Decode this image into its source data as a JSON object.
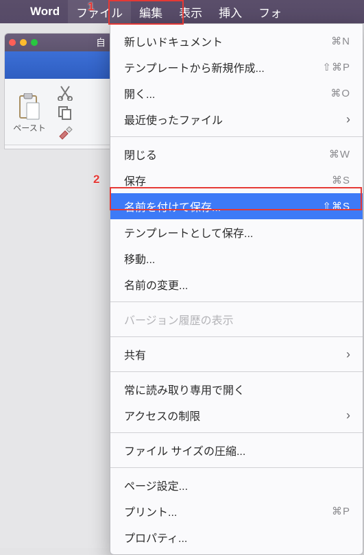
{
  "menubar": {
    "app_name": "Word",
    "items": [
      "ファイル",
      "編集",
      "表示",
      "挿入",
      "フォ"
    ]
  },
  "window": {
    "autofit": "自",
    "paste_label": "ペースト"
  },
  "annotations": {
    "one": "1",
    "two": "2"
  },
  "menu": [
    {
      "type": "item",
      "label": "新しいドキュメント",
      "shortcut": "⌘N"
    },
    {
      "type": "item",
      "label": "テンプレートから新規作成...",
      "shortcut": "⇧⌘P"
    },
    {
      "type": "item",
      "label": "開く...",
      "shortcut": "⌘O"
    },
    {
      "type": "submenu",
      "label": "最近使ったファイル"
    },
    {
      "type": "sep"
    },
    {
      "type": "item",
      "label": "閉じる",
      "shortcut": "⌘W"
    },
    {
      "type": "item",
      "label": "保存",
      "shortcut": "⌘S"
    },
    {
      "type": "item",
      "label": "名前を付けて保存...",
      "shortcut": "⇧⌘S",
      "highlight": true
    },
    {
      "type": "item",
      "label": "テンプレートとして保存..."
    },
    {
      "type": "item",
      "label": "移動..."
    },
    {
      "type": "item",
      "label": "名前の変更..."
    },
    {
      "type": "sep"
    },
    {
      "type": "disabled",
      "label": "バージョン履歴の表示"
    },
    {
      "type": "sep"
    },
    {
      "type": "submenu",
      "label": "共有"
    },
    {
      "type": "sep"
    },
    {
      "type": "item",
      "label": "常に読み取り専用で開く"
    },
    {
      "type": "submenu",
      "label": "アクセスの制限"
    },
    {
      "type": "sep"
    },
    {
      "type": "item",
      "label": "ファイル サイズの圧縮..."
    },
    {
      "type": "sep"
    },
    {
      "type": "item",
      "label": "ページ設定..."
    },
    {
      "type": "item",
      "label": "プリント...",
      "shortcut": "⌘P"
    },
    {
      "type": "item",
      "label": "プロパティ..."
    }
  ]
}
